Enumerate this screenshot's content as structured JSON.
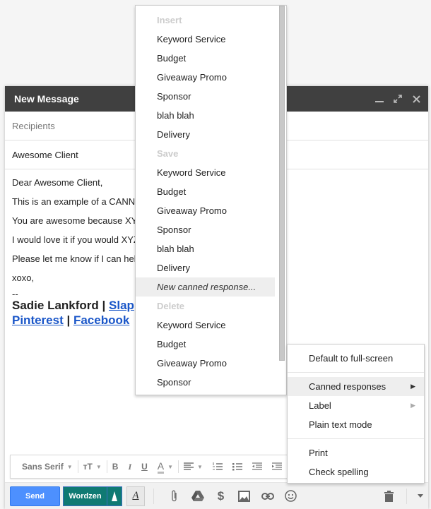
{
  "compose": {
    "title": "New Message",
    "controls": {
      "minimize": "_",
      "expand": "⤢",
      "close": "✕"
    },
    "recipients_placeholder": "Recipients",
    "subject": "Awesome Client",
    "body_lines": [
      "Dear Awesome Client,",
      "This is an example of a CANN",
      "You are awesome because XY",
      "I would love it if you would XYZ",
      "Please let me know if I can hel",
      "xoxo,"
    ],
    "signature": {
      "dash": "--",
      "name": "Sadie Lankford",
      "sep": " | ",
      "link1": "Slap",
      "link2": "Pinterest",
      "link3": "Facebook"
    }
  },
  "format_toolbar": {
    "font": "Sans Serif",
    "size_icon": "тT",
    "bold": "B",
    "italic": "I",
    "underline": "U",
    "text_color": "A"
  },
  "bottom_bar": {
    "send_label": "Send",
    "wordzen_label": "Wordzen",
    "format_label": "A"
  },
  "canned_menu": {
    "insert_header": "Insert",
    "insert_items": [
      "Keyword Service",
      "Budget",
      "Giveaway Promo",
      "Sponsor",
      "blah blah",
      "Delivery"
    ],
    "save_header": "Save",
    "save_items": [
      "Keyword Service",
      "Budget",
      "Giveaway Promo",
      "Sponsor",
      "blah blah",
      "Delivery"
    ],
    "new_item": "New canned response...",
    "delete_header": "Delete",
    "delete_items": [
      "Keyword Service",
      "Budget",
      "Giveaway Promo",
      "Sponsor"
    ]
  },
  "more_menu": {
    "items": [
      {
        "label": "Default to full-screen"
      },
      {
        "label": "Canned responses"
      },
      {
        "label": "Label"
      },
      {
        "label": "Plain text mode"
      },
      {
        "label": "Print"
      },
      {
        "label": "Check spelling"
      }
    ]
  },
  "colors": {
    "titlebar": "#404040",
    "send_blue": "#4d90fe",
    "wordzen_teal": "#0f7a73",
    "link_blue": "#1a56c8"
  }
}
